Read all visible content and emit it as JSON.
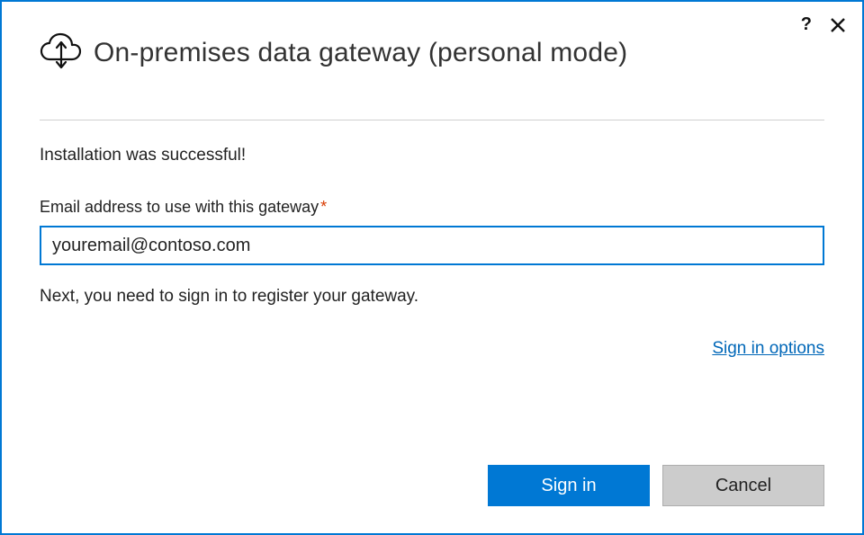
{
  "header": {
    "title": "On-premises data gateway (personal mode)"
  },
  "content": {
    "status": "Installation was successful!",
    "email_label": "Email address to use with this gateway",
    "required_mark": "*",
    "email_value": "youremail@contoso.com",
    "instruction": "Next, you need to sign in to register your gateway.",
    "signin_options_label": "Sign in options"
  },
  "buttons": {
    "primary": "Sign in",
    "secondary": "Cancel"
  },
  "icons": {
    "help": "?",
    "close": "close-icon",
    "cloud": "cloud-gateway-icon"
  }
}
